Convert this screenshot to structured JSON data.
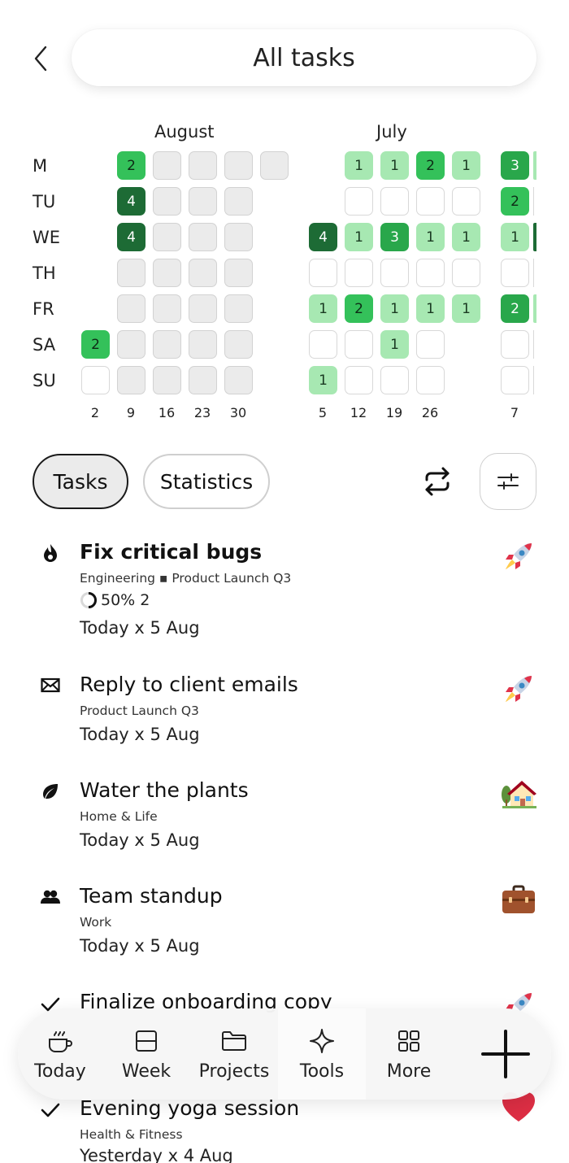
{
  "header": {
    "title": "All tasks"
  },
  "calendar": {
    "months": [
      "August",
      "July"
    ],
    "days": [
      "M",
      "TU",
      "WE",
      "TH",
      "FR",
      "SA",
      "SU"
    ],
    "week_labels": [
      "2",
      "9",
      "16",
      "23",
      "30",
      "5",
      "12",
      "19",
      "26",
      "7"
    ],
    "cell_values": {
      "aug_m_9": "2",
      "aug_tu_9": "4",
      "aug_we_9": "4",
      "aug_sa_2": "2",
      "jul_m_12": "1",
      "jul_m_19": "1",
      "jul_m_26": "2",
      "jul_m_a": "1",
      "jul_m_7": "3",
      "jul_tu_7": "2",
      "jul_we_5": "4",
      "jul_we_12": "1",
      "jul_we_19": "3",
      "jul_we_26": "1",
      "jul_we_a": "1",
      "jul_we_7": "1",
      "jul_fr_5": "1",
      "jul_fr_12": "2",
      "jul_fr_19": "1",
      "jul_fr_26": "1",
      "jul_fr_a": "1",
      "jul_fr_7": "2",
      "jul_sa_19": "1",
      "jul_su_5": "1"
    },
    "colors": {
      "level1": "#a7e8b2",
      "level2": "#34c15a",
      "level3": "#29a74b",
      "level4": "#1d6b35"
    }
  },
  "tabs": {
    "tasks": "Tasks",
    "statistics": "Statistics"
  },
  "tasks": [
    {
      "icon": "flame-icon",
      "title": "Fix critical bugs",
      "subtitle": "Engineering ▪ Product Launch Q3",
      "progress": "50% 2",
      "date": "Today x 5 Aug",
      "badge": "rocket"
    },
    {
      "icon": "envelope-icon",
      "title": "Reply to client emails",
      "subtitle": "Product Launch Q3",
      "date": "Today x 5 Aug",
      "badge": "rocket"
    },
    {
      "icon": "leaf-icon",
      "title": "Water the plants",
      "subtitle": "Home & Life",
      "date": "Today x 5 Aug",
      "badge": "house"
    },
    {
      "icon": "people-icon",
      "title": "Team standup",
      "subtitle": "Work",
      "date": "Today x 5 Aug",
      "badge": "briefcase"
    },
    {
      "icon": "check-icon",
      "title": "Finalize onboarding copy",
      "badge": "rocket"
    },
    {
      "icon": "check-icon",
      "title": "Evening yoga session",
      "subtitle": "Health & Fitness",
      "date": "Yesterday x 4 Aug",
      "badge": "heart"
    }
  ],
  "nav": {
    "today": "Today",
    "week": "Week",
    "projects": "Projects",
    "tools": "Tools",
    "more": "More"
  }
}
